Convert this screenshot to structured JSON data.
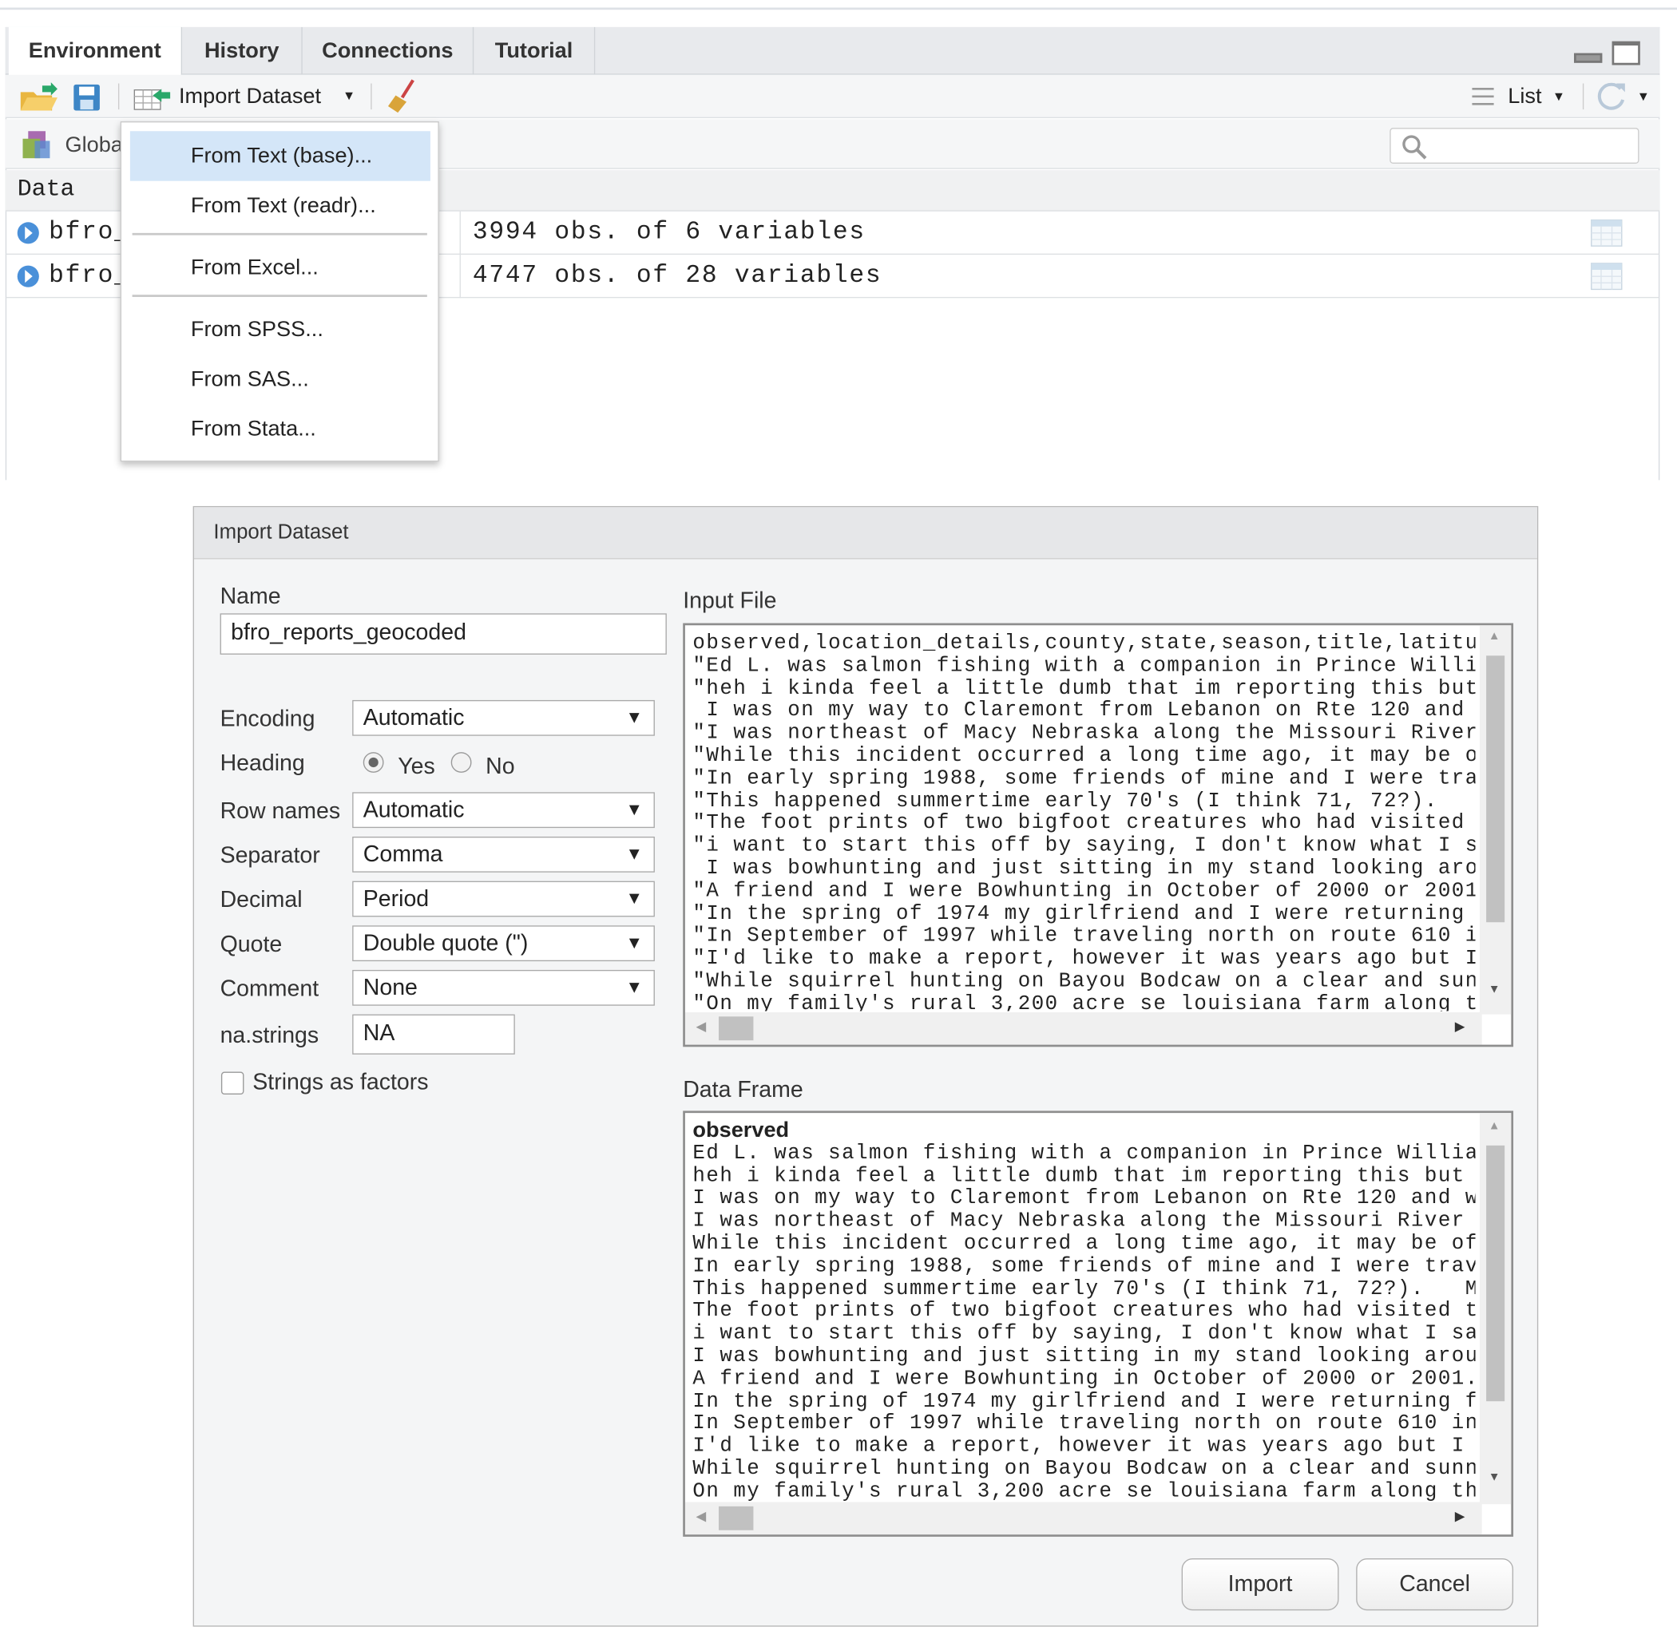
{
  "tabs": [
    {
      "label": "Environment",
      "active": true
    },
    {
      "label": "History"
    },
    {
      "label": "Connections"
    },
    {
      "label": "Tutorial"
    }
  ],
  "toolbar": {
    "import_label": "Import Dataset",
    "view_label": "List"
  },
  "environment": {
    "scope_label": "Global Environment",
    "section": "Data",
    "search_placeholder": "",
    "rows": [
      {
        "name": "bfro_",
        "value": "3994 obs. of 6 variables"
      },
      {
        "name": "bfro_",
        "value": "4747 obs. of 28 variables"
      }
    ]
  },
  "import_menu": {
    "items": [
      "From Text (base)...",
      "From Text (readr)...",
      "From Excel...",
      "From SPSS...",
      "From SAS...",
      "From Stata..."
    ],
    "highlighted": "From Text (base)..."
  },
  "dialog": {
    "title": "Import Dataset",
    "name_label": "Name",
    "name_value": "bfro_reports_geocoded",
    "encoding_label": "Encoding",
    "encoding_value": "Automatic",
    "heading_label": "Heading",
    "heading_yes": "Yes",
    "heading_no": "No",
    "heading_selected": "Yes",
    "rownames_label": "Row names",
    "rownames_value": "Automatic",
    "separator_label": "Separator",
    "separator_value": "Comma",
    "decimal_label": "Decimal",
    "decimal_value": "Period",
    "quote_label": "Quote",
    "quote_value": "Double quote (\")",
    "comment_label": "Comment",
    "comment_value": "None",
    "na_label": "na.strings",
    "na_value": "NA",
    "factors_label": "Strings as factors",
    "factors_checked": false,
    "input_file_label": "Input File",
    "input_file_text": "observed,location_details,county,state,season,title,latitud\n\"Ed L. was salmon fishing with a companion in Prince Willia\n\"heh i kinda feel a little dumb that im reporting this but \n I was on my way to Claremont from Lebanon on Rte 120 and wa\n\"I was northeast of Macy Nebraska along the Missouri River \n\"While this incident occurred a long time ago, it may be of\n\"In early spring 1988, some friends of mine and I were trav\n\"This happened summertime early 70's (I think 71, 72?).   M\n\"The foot prints of two bigfoot creatures who had visited t\n\"i want to start this off by saying, I don't know what I sa\n I was bowhunting and just sitting in my stand looking arou\n\"A friend and I were Bowhunting in October of 2000 or 2001.\n\"In the spring of 1974 my girlfriend and I were returning f\n\"In September of 1997 while traveling north on route 610 in\n\"I'd like to make a report, however it was years ago but I \n\"While squirrel hunting on Bayou Bodcaw on a clear and sunn\n\"On my family's rural 3,200 acre se louisiana farm along th",
    "data_frame_label": "Data Frame",
    "data_frame_header": "observed",
    "data_frame_text": "Ed L. was salmon fishing with a companion in Prince Willian\nheh i kinda feel a little dumb that im reporting this but i\nI was on my way to Claremont from Lebanon on Rte 120 and wa\nI was northeast of Macy Nebraska along the Missouri River t\nWhile this incident occurred a long time ago, it may be ofs\nIn early spring 1988, some friends of mine and I were trave\nThis happened summertime early 70's (I think 71, 72?).   Me\nThe foot prints of two bigfoot creatures who had visited th\ni want to start this off by saying, I don't know what I saw\nI was bowhunting and just sitting in my stand looking aroun\nA friend and I were Bowhunting in October of 2000 or 2001.\\\nIn the spring of 1974 my girlfriend and I were returning fr\nIn September of 1997 while traveling north on route 610 in \nI'd like to make a report, however it was years ago but I r\nWhile squirrel hunting on Bayou Bodcaw on a clear and sunny\nOn my family's rural 3,200 acre se louisiana farm along the",
    "import_button": "Import",
    "cancel_button": "Cancel"
  },
  "icons": [
    "open-folder-icon",
    "save-icon",
    "import-dataset-icon",
    "broom-icon",
    "list-icon",
    "refresh-icon",
    "search-icon",
    "grid-icon",
    "expand-icon",
    "minimize-icon",
    "maximize-icon"
  ]
}
